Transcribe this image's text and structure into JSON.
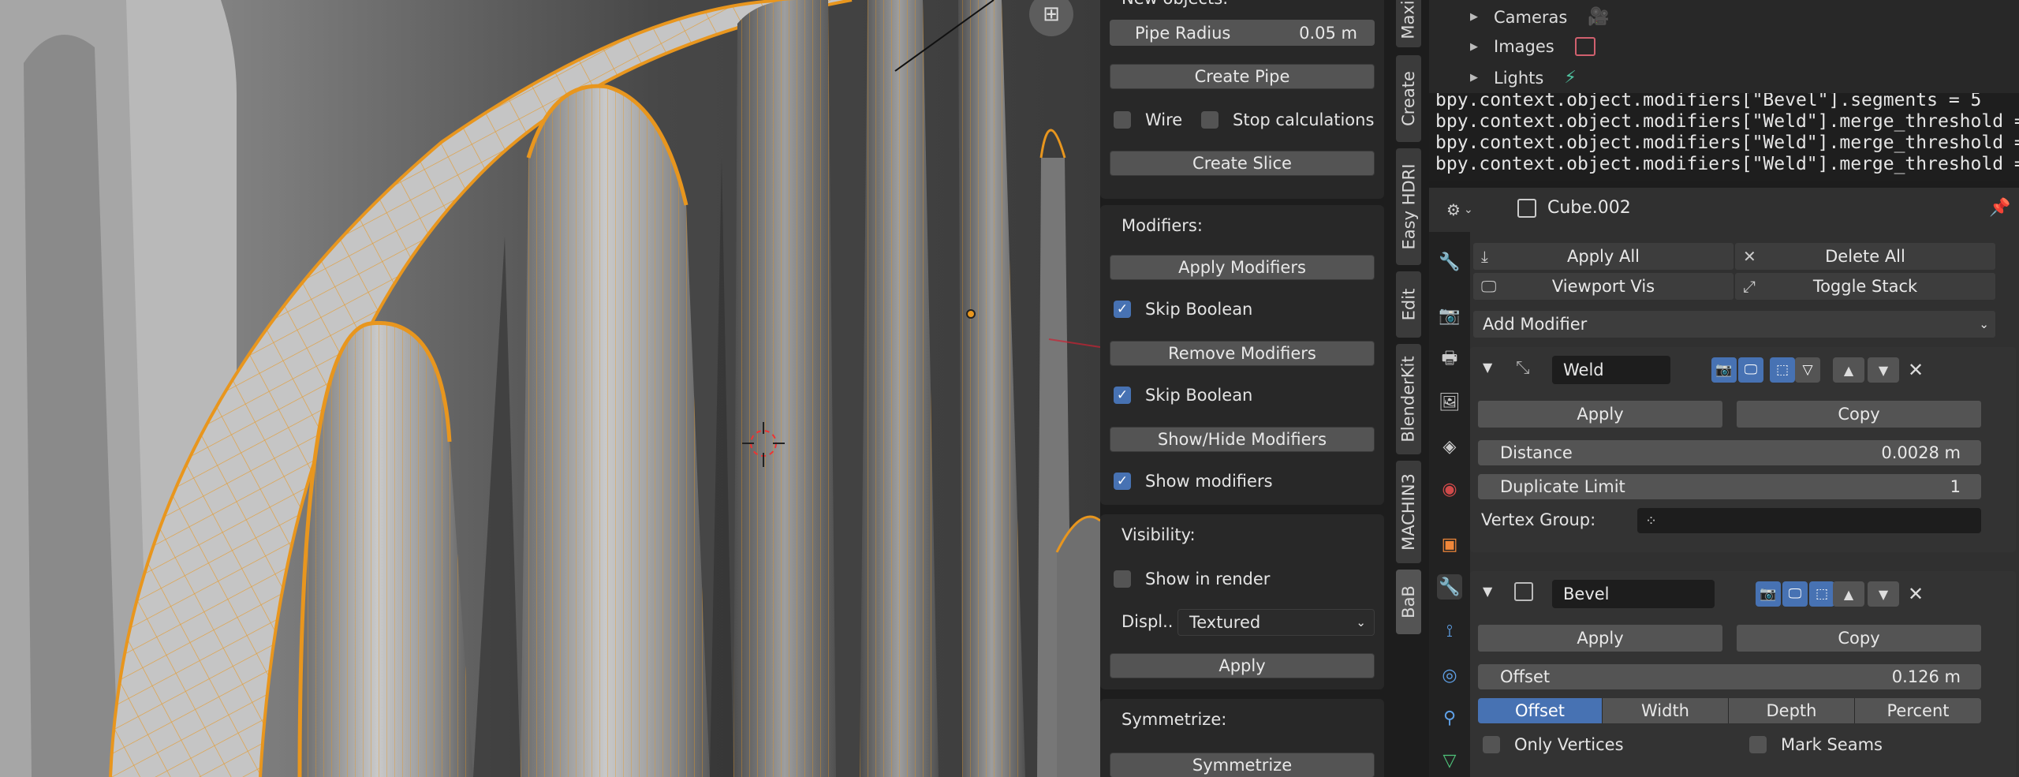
{
  "npanel": {
    "new_objects_label": "New objects:",
    "pipe_radius_label": "Pipe Radius",
    "pipe_radius_value": "0.05 m",
    "create_pipe": "Create Pipe",
    "wire_label": "Wire",
    "stop_calc_label": "Stop calculations",
    "create_slice": "Create Slice",
    "modifiers_label": "Modifiers:",
    "apply_modifiers": "Apply Modifiers",
    "skip_boolean_1": "Skip Boolean",
    "remove_modifiers": "Remove Modifiers",
    "skip_boolean_2": "Skip Boolean",
    "show_hide_modifiers": "Show/Hide Modifiers",
    "show_modifiers": "Show modifiers",
    "visibility_label": "Visibility:",
    "show_in_render": "Show in render",
    "display_label": "Displ..",
    "display_value": "Textured",
    "apply": "Apply",
    "symmetrize_label": "Symmetrize:",
    "symmetrize_btn": "Symmetrize"
  },
  "vtabs": [
    "Maxi",
    "Create",
    "Easy HDRI",
    "Edit",
    "BlenderKit",
    "MACHIN3",
    "BaB"
  ],
  "outliner": {
    "items": [
      "Cameras",
      "Images",
      "Lights"
    ]
  },
  "console": {
    "lines": [
      "bpy.context.object.modifiers[\"Bevel\"].segments = 5",
      "bpy.context.object.modifiers[\"Weld\"].merge_threshold = 0.",
      "bpy.context.object.modifiers[\"Weld\"].merge_threshold = 0.",
      "bpy.context.object.modifiers[\"Weld\"].merge_threshold = 0."
    ]
  },
  "props": {
    "object_name": "Cube.002",
    "apply_all": "Apply All",
    "delete_all": "Delete All",
    "viewport_vis": "Viewport Vis",
    "toggle_stack": "Toggle Stack",
    "add_modifier": "Add Modifier",
    "weld": {
      "name": "Weld",
      "apply": "Apply",
      "copy": "Copy",
      "distance_label": "Distance",
      "distance_value": "0.0028 m",
      "dup_limit_label": "Duplicate Limit",
      "dup_limit_value": "1",
      "vertex_group_label": "Vertex Group:"
    },
    "bevel": {
      "name": "Bevel",
      "apply": "Apply",
      "copy": "Copy",
      "offset_label": "Offset",
      "offset_value": "0.126 m",
      "width_types": [
        "Offset",
        "Width",
        "Depth",
        "Percent"
      ],
      "only_vertices": "Only Vertices",
      "mark_seams": "Mark Seams"
    }
  },
  "colors": {
    "accent": "#4772b3",
    "selection_orange": "#e8961e"
  }
}
